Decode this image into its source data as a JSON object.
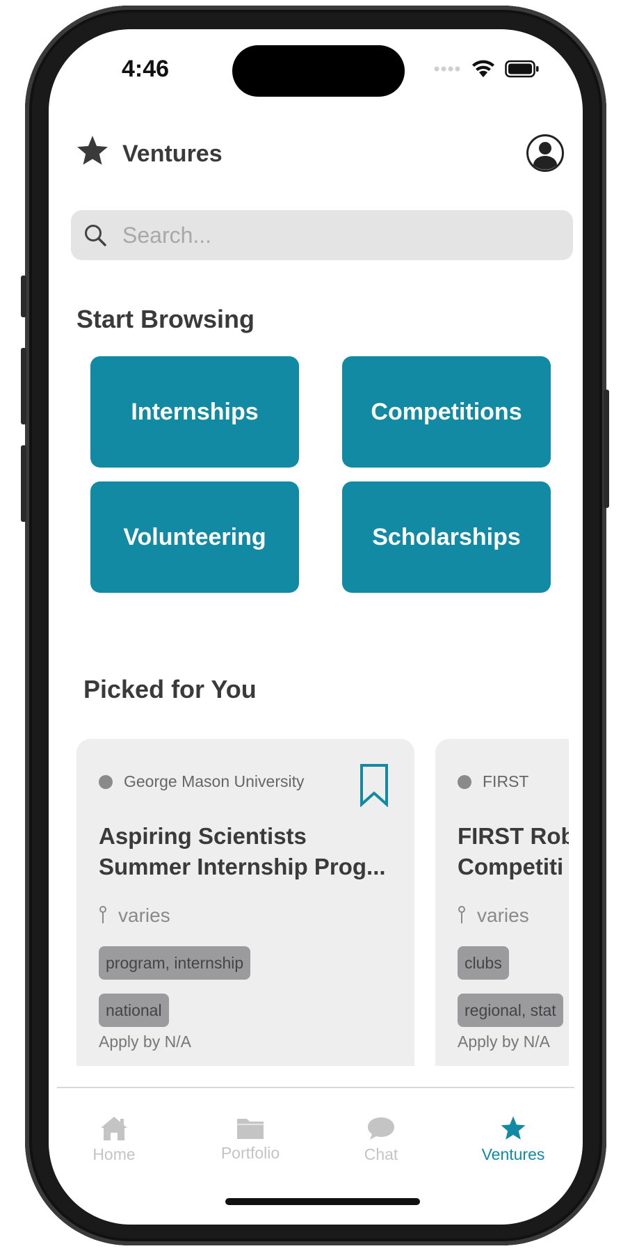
{
  "status_bar": {
    "time": "4:46"
  },
  "header": {
    "title": "Ventures"
  },
  "search": {
    "placeholder": "Search..."
  },
  "start_browsing": {
    "title": "Start Browsing",
    "categories": [
      "Internships",
      "Competitions",
      "Volunteering",
      "Scholarships"
    ]
  },
  "picked_for_you": {
    "title": "Picked for You",
    "cards": [
      {
        "org": "George Mason University",
        "title_line1": "Aspiring Scientists",
        "title_line2": "Summer Internship Prog...",
        "location": "varies",
        "tags": [
          "program, internship",
          "national"
        ],
        "deadline": "Apply by N/A"
      },
      {
        "org": "FIRST",
        "title_line1": "FIRST Rob",
        "title_line2": "Competiti",
        "location": "varies",
        "tags": [
          "clubs",
          "regional, stat"
        ],
        "deadline": "Apply by N/A"
      }
    ]
  },
  "tab_bar": {
    "tabs": [
      {
        "label": "Home",
        "icon": "house-icon"
      },
      {
        "label": "Portfolio",
        "icon": "folder-icon"
      },
      {
        "label": "Chat",
        "icon": "chat-bubble-icon"
      },
      {
        "label": "Ventures",
        "icon": "star-icon"
      }
    ],
    "active": "Ventures"
  },
  "colors": {
    "accent": "#138aa3",
    "card_background": "#eeeeee",
    "tag_background": "#9b9b9d",
    "search_background": "#e4e4e4",
    "inactive_tab": "#c4c4c4"
  }
}
